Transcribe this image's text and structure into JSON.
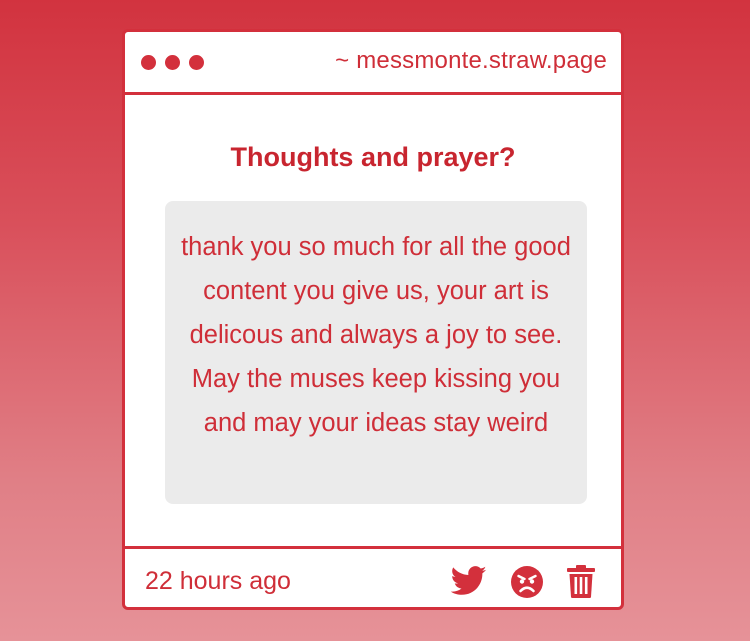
{
  "window": {
    "url": "~ messmonte.straw.page"
  },
  "post": {
    "question": "Thoughts and prayer?",
    "answer": "thank you so much for all the good content you give us, your art is delicous and always a joy to see. May the muses keep kissing you and may your ideas stay weird",
    "timestamp": "22 hours ago"
  },
  "actions": {
    "icons": [
      "twitter-icon",
      "angry-face-icon",
      "trash-icon"
    ]
  },
  "colors": {
    "accent": "#d3303c",
    "text": "#cf2e38",
    "answer_bg": "#ebebeb",
    "card_bg": "#ffffff"
  }
}
